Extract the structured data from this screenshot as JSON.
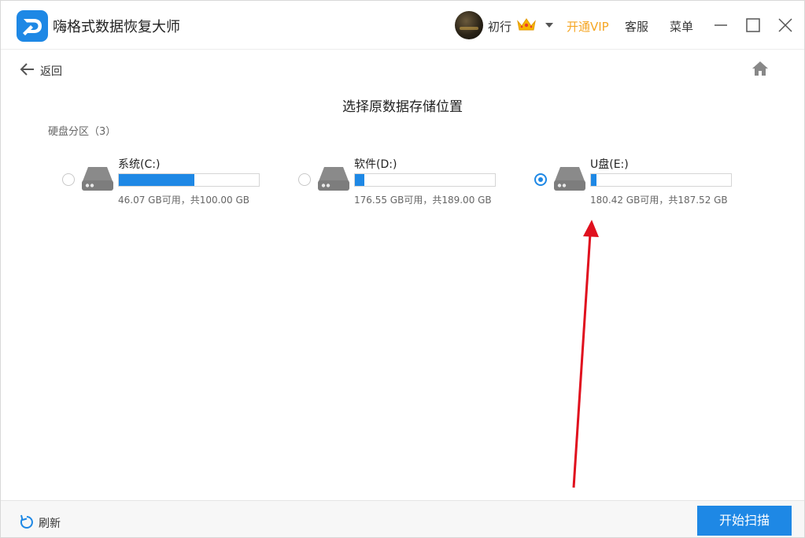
{
  "app": {
    "title": "嗨格式数据恢复大师",
    "username": "初行",
    "vip_label": "开通VIP",
    "service_label": "客服",
    "menu_label": "菜单"
  },
  "nav": {
    "back_label": "返回"
  },
  "page": {
    "title": "选择原数据存储位置",
    "section_label": "硬盘分区（3）"
  },
  "drives": [
    {
      "name": "系统(C:)",
      "info": "46.07 GB可用，共100.00 GB",
      "used_fraction": 0.54,
      "selected": false
    },
    {
      "name": "软件(D:)",
      "info": "176.55 GB可用，共189.00 GB",
      "used_fraction": 0.066,
      "selected": false
    },
    {
      "name": "U盘(E:)",
      "info": "180.42 GB可用，共187.52 GB",
      "used_fraction": 0.038,
      "selected": true
    }
  ],
  "footer": {
    "refresh_label": "刷新",
    "scan_label": "开始扫描"
  },
  "colors": {
    "accent": "#1e88e5",
    "vip": "#f5a623",
    "annotation_arrow": "#e0101e"
  },
  "icons": {
    "logo": "app-logo-d",
    "crown": "crown-icon",
    "back": "arrow-left-icon",
    "home": "home-icon",
    "drive": "hard-drive-icon",
    "refresh": "refresh-icon"
  }
}
